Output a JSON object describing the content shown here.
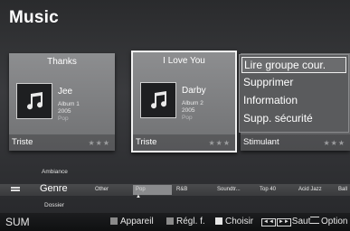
{
  "title": "Music",
  "cards": [
    {
      "song": "Thanks",
      "artist": "Jee",
      "album": "Album 1",
      "year": "2005",
      "genre": "Pop",
      "mood": "Triste",
      "stars": "★★★"
    },
    {
      "song": "I Love You",
      "artist": "Darby",
      "album": "Album 2",
      "year": "2005",
      "genre": "Pop",
      "mood": "Triste",
      "stars": "★★★"
    },
    {
      "mood": "Stimulant",
      "stars": "★★★"
    }
  ],
  "context_menu": {
    "items": [
      "Lire groupe cour.",
      "Supprimer",
      "Information",
      "Supp. sécurité"
    ],
    "selected_index": 0
  },
  "filter": {
    "above": "Ambiance",
    "current": "Genre",
    "below": "Dossier",
    "chips": [
      "Other",
      "Pop",
      "R&B",
      "Soundtr...",
      "Top 40",
      "Acid Jazz",
      "Ball"
    ],
    "selected_chip": "Pop"
  },
  "statusbar": {
    "source": "SUM",
    "appareil": "Appareil",
    "regl": "Régl. f.",
    "choisir": "Choisir",
    "saut": "Saut",
    "option": "Option",
    "colors": {
      "gray": "#9a9a9a"
    }
  },
  "icons": {
    "card_art": "music-note-icon",
    "genre": "list-icon",
    "option": "menu-icon",
    "saut": "skip-icon"
  }
}
